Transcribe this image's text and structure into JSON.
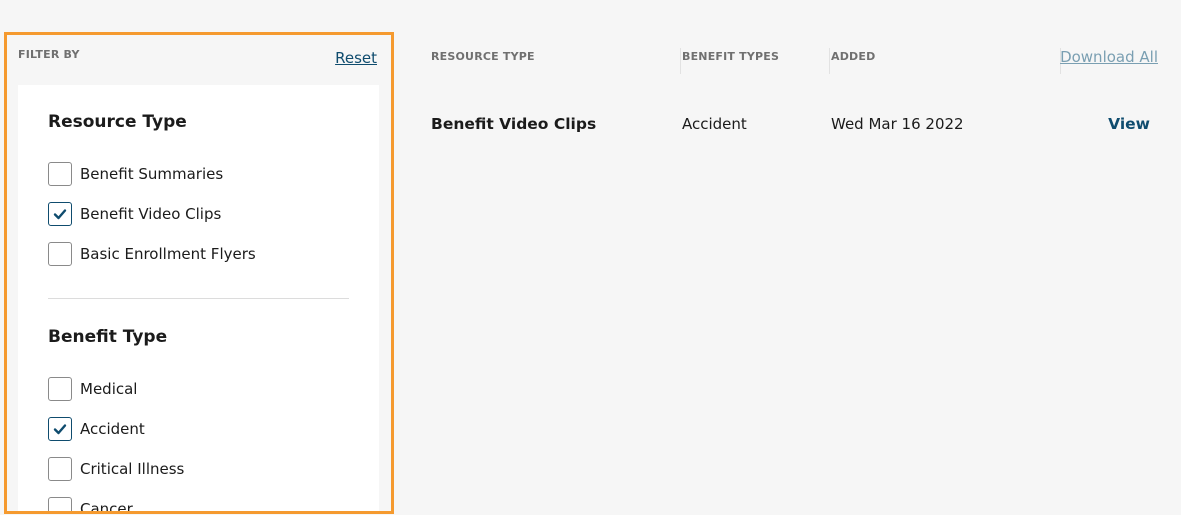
{
  "filter": {
    "heading": "FILTER BY",
    "reset_label": "Reset",
    "resource_type": {
      "title": "Resource Type",
      "options": [
        {
          "label": "Benefit Summaries",
          "checked": false
        },
        {
          "label": "Benefit Video Clips",
          "checked": true
        },
        {
          "label": "Basic Enrollment Flyers",
          "checked": false
        }
      ]
    },
    "benefit_type": {
      "title": "Benefit Type",
      "options": [
        {
          "label": "Medical",
          "checked": false
        },
        {
          "label": "Accident",
          "checked": true
        },
        {
          "label": "Critical Illness",
          "checked": false
        },
        {
          "label": "Cancer",
          "checked": false
        }
      ]
    }
  },
  "table": {
    "headers": {
      "resource_type": "RESOURCE TYPE",
      "benefit_types": "BENEFIT TYPES",
      "added": "ADDED"
    },
    "download_all_label": "Download All",
    "rows": [
      {
        "resource_type": "Benefit Video Clips",
        "benefit_types": "Accident",
        "added": "Wed Mar 16 2022",
        "action_label": "View"
      }
    ]
  },
  "colors": {
    "accent_border": "#f59a2f",
    "link": "#0f4c6e",
    "muted_link": "#7a9fb2",
    "background": "#f6f6f6"
  }
}
